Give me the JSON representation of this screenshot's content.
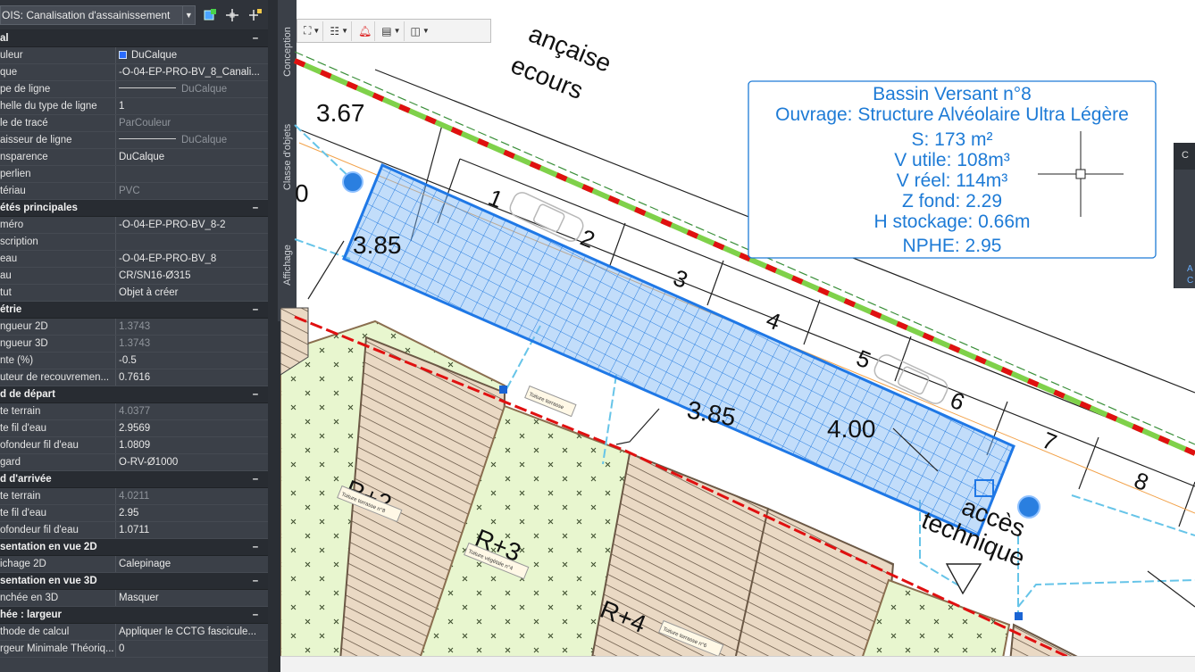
{
  "palette": {
    "selector_label": "OIS: Canalisation d'assainissement",
    "sections": [
      {
        "title": "al",
        "rows": [
          {
            "k": "uleur",
            "v": "DuCalque",
            "swatch": "#2a6cff"
          },
          {
            "k": "que",
            "v": "-O-04-EP-PRO-BV_8_Canali..."
          },
          {
            "k": "pe de ligne",
            "v": "DuCalque",
            "line": true,
            "dim": true
          },
          {
            "k": "helle du type de ligne",
            "v": "1"
          },
          {
            "k": "le de tracé",
            "v": "ParCouleur",
            "dim": true
          },
          {
            "k": "aisseur de ligne",
            "v": "DuCalque",
            "line": true,
            "dim": true
          },
          {
            "k": "nsparence",
            "v": "DuCalque"
          },
          {
            "k": "perlien",
            "v": ""
          },
          {
            "k": "tériau",
            "v": "PVC",
            "dim": true
          }
        ]
      },
      {
        "title": "étés principales",
        "rows": [
          {
            "k": "méro",
            "v": "-O-04-EP-PRO-BV_8-2"
          },
          {
            "k": "scription",
            "v": ""
          },
          {
            "k": "eau",
            "v": "-O-04-EP-PRO-BV_8"
          },
          {
            "k": "au",
            "v": "CR/SN16-Ø315"
          },
          {
            "k": "tut",
            "v": "Objet à créer"
          }
        ]
      },
      {
        "title": "étrie",
        "rows": [
          {
            "k": "ngueur 2D",
            "v": "1.3743",
            "dim": true
          },
          {
            "k": "ngueur 3D",
            "v": "1.3743",
            "dim": true
          },
          {
            "k": "nte (%)",
            "v": "-0.5"
          },
          {
            "k": "uteur  de  recouvremen...",
            "v": "0.7616"
          }
        ]
      },
      {
        "title": "d de départ",
        "rows": [
          {
            "k": "te terrain",
            "v": "4.0377",
            "dim": true
          },
          {
            "k": "te fil d'eau",
            "v": "2.9569"
          },
          {
            "k": "ofondeur fil d'eau",
            "v": "1.0809"
          },
          {
            "k": "gard",
            "v": "O-RV-Ø1000"
          }
        ]
      },
      {
        "title": "d d'arrivée",
        "rows": [
          {
            "k": "te terrain",
            "v": "4.0211",
            "dim": true
          },
          {
            "k": "te fil d'eau",
            "v": "2.95"
          },
          {
            "k": "ofondeur fil d'eau",
            "v": "1.0711"
          }
        ]
      },
      {
        "title": "sentation en vue 2D",
        "rows": [
          {
            "k": "ichage 2D",
            "v": "Calepinage"
          }
        ]
      },
      {
        "title": "sentation en vue 3D",
        "rows": [
          {
            "k": "nchée en 3D",
            "v": "Masquer"
          }
        ]
      },
      {
        "title": "hée : largeur",
        "rows": [
          {
            "k": "thode de calcul",
            "v": "Appliquer  le  CCTG  fascicule..."
          },
          {
            "k": "rgeur Minimale Théoriq...",
            "v": "0"
          }
        ]
      }
    ]
  },
  "side_tabs": [
    "Conception",
    "Classe d'objets",
    "Affichage"
  ],
  "annotation": {
    "lines": [
      "Bassin Versant n°8",
      "Ouvrage: Structure Alvéolaire Ultra Légère",
      "S: 173 m²",
      "V utile: 108m³",
      "V réel: 114m³",
      "Z fond: 2.29",
      "H stockage: 0.66m",
      "NPHE: 2.95"
    ],
    "color": "#1e7bd6"
  },
  "drawing": {
    "street_text": [
      "ançaise",
      "ecours"
    ],
    "dims": [
      "3.67",
      "3.85",
      "3.85",
      "4.00"
    ],
    "parking_numbers": [
      "1",
      "2",
      "3",
      "4",
      "5",
      "6",
      "7",
      "8"
    ],
    "left_digit": "0",
    "acces_text": "accès",
    "technique_text": "technique",
    "building_labels": [
      "R+2",
      "R+3",
      "R+4"
    ],
    "small_notes": [
      "Toiture terrasse n°8",
      "Toiture végétale n°4",
      "Toiture terrasse n°6",
      "Toiture terrasse"
    ]
  },
  "right_palette": {
    "header": "C",
    "links": [
      "A",
      "C"
    ]
  }
}
